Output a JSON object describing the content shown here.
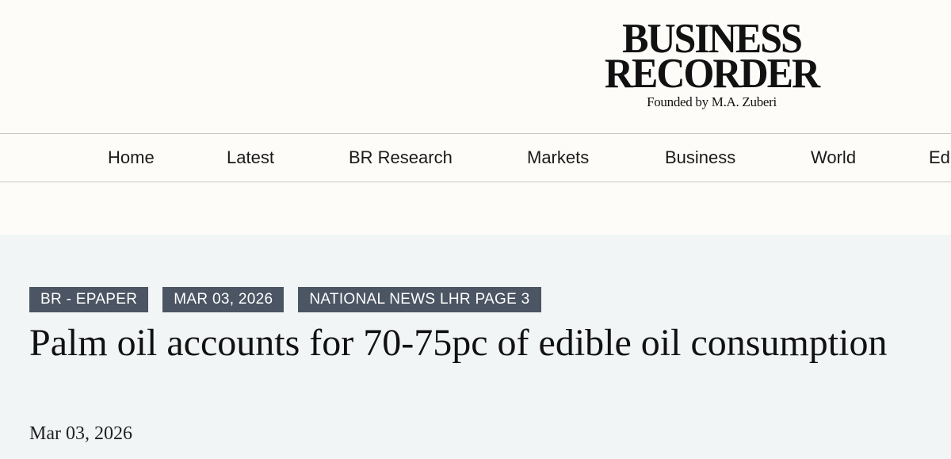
{
  "masthead": {
    "logo_line1": "BUSINESS",
    "logo_line2": "RECORDER",
    "tagline": "Founded by M.A. Zuberi"
  },
  "nav": {
    "items": [
      {
        "label": "Home"
      },
      {
        "label": "Latest"
      },
      {
        "label": "BR Research"
      },
      {
        "label": "Markets"
      },
      {
        "label": "Business"
      },
      {
        "label": "World"
      },
      {
        "label": "Ed"
      }
    ]
  },
  "article": {
    "tags": [
      {
        "label": "BR - EPAPER"
      },
      {
        "label": "MAR 03, 2026"
      },
      {
        "label": "NATIONAL NEWS LHR PAGE 3"
      }
    ],
    "headline": "Palm oil accounts for 70-75pc of edible oil consumption",
    "date": "Mar 03, 2026"
  },
  "colors": {
    "page_background": "#fdfcf8",
    "article_background": "#f1f5f6",
    "tag_background": "#4b5563",
    "tag_text": "#ffffff",
    "text": "#111111",
    "divider": "#c9c6bd"
  }
}
